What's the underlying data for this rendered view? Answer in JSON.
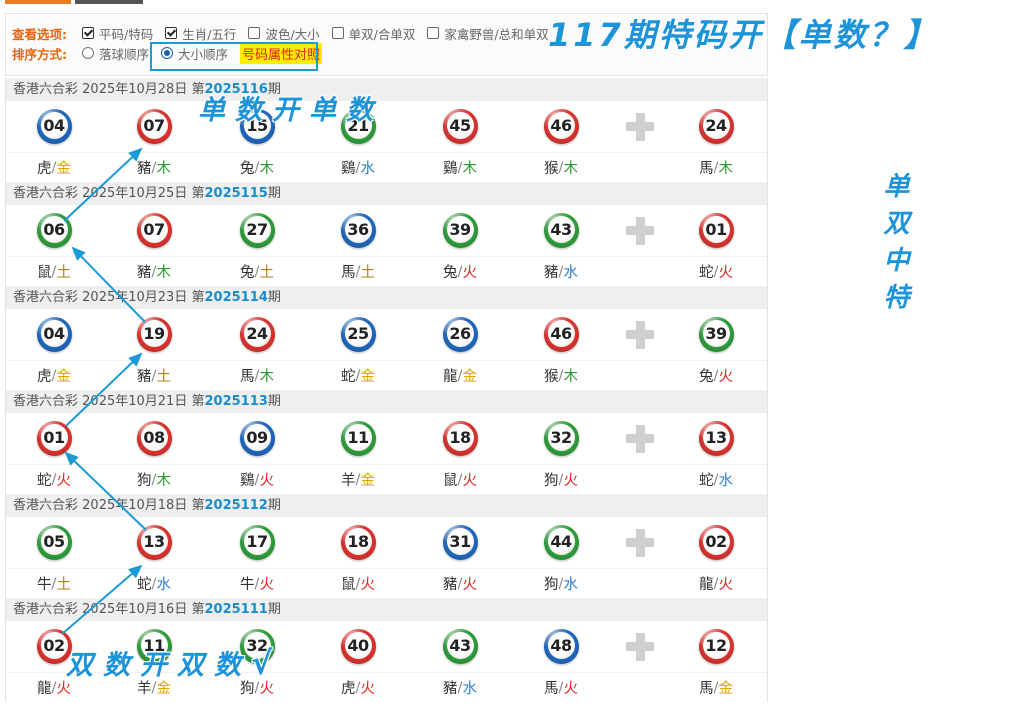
{
  "options": {
    "view_label": "查看选项:",
    "view_items": [
      {
        "label": "平码/特码",
        "checked": true
      },
      {
        "label": "生肖/五行",
        "checked": true
      },
      {
        "label": "波色/大小",
        "checked": false
      },
      {
        "label": "单双/合单双",
        "checked": false
      },
      {
        "label": "家禽野兽/总和单双",
        "checked": false
      }
    ],
    "sort_label": "排序方式:",
    "sort_items": [
      {
        "label": "落球顺序",
        "selected": false
      },
      {
        "label": "大小顺序",
        "selected": true
      }
    ],
    "attr_link": "号码属性对照"
  },
  "draw_labels": {
    "lottery": "香港六合彩",
    "issue_prefix": "第",
    "issue_suffix": "期",
    "separator": "/"
  },
  "draws": [
    {
      "date": "2025年10月28日",
      "issue": "2025116",
      "balls": [
        {
          "num": "04",
          "color": "blue",
          "zodiac": "虎",
          "element": "金"
        },
        {
          "num": "07",
          "color": "red",
          "zodiac": "豬",
          "element": "木"
        },
        {
          "num": "15",
          "color": "blue",
          "zodiac": "兔",
          "element": "木"
        },
        {
          "num": "21",
          "color": "green",
          "zodiac": "鷄",
          "element": "水"
        },
        {
          "num": "45",
          "color": "red",
          "zodiac": "鷄",
          "element": "木"
        },
        {
          "num": "46",
          "color": "red",
          "zodiac": "猴",
          "element": "木"
        }
      ],
      "special": {
        "num": "24",
        "color": "red",
        "zodiac": "馬",
        "element": "木"
      }
    },
    {
      "date": "2025年10月25日",
      "issue": "2025115",
      "balls": [
        {
          "num": "06",
          "color": "green",
          "zodiac": "鼠",
          "element": "土"
        },
        {
          "num": "07",
          "color": "red",
          "zodiac": "豬",
          "element": "木"
        },
        {
          "num": "27",
          "color": "green",
          "zodiac": "兔",
          "element": "土"
        },
        {
          "num": "36",
          "color": "blue",
          "zodiac": "馬",
          "element": "土"
        },
        {
          "num": "39",
          "color": "green",
          "zodiac": "兔",
          "element": "火"
        },
        {
          "num": "43",
          "color": "green",
          "zodiac": "豬",
          "element": "水"
        }
      ],
      "special": {
        "num": "01",
        "color": "red",
        "zodiac": "蛇",
        "element": "火"
      }
    },
    {
      "date": "2025年10月23日",
      "issue": "2025114",
      "balls": [
        {
          "num": "04",
          "color": "blue",
          "zodiac": "虎",
          "element": "金"
        },
        {
          "num": "19",
          "color": "red",
          "zodiac": "豬",
          "element": "土"
        },
        {
          "num": "24",
          "color": "red",
          "zodiac": "馬",
          "element": "木"
        },
        {
          "num": "25",
          "color": "blue",
          "zodiac": "蛇",
          "element": "金"
        },
        {
          "num": "26",
          "color": "blue",
          "zodiac": "龍",
          "element": "金"
        },
        {
          "num": "46",
          "color": "red",
          "zodiac": "猴",
          "element": "木"
        }
      ],
      "special": {
        "num": "39",
        "color": "green",
        "zodiac": "兔",
        "element": "火"
      }
    },
    {
      "date": "2025年10月21日",
      "issue": "2025113",
      "balls": [
        {
          "num": "01",
          "color": "red",
          "zodiac": "蛇",
          "element": "火"
        },
        {
          "num": "08",
          "color": "red",
          "zodiac": "狗",
          "element": "木"
        },
        {
          "num": "09",
          "color": "blue",
          "zodiac": "鷄",
          "element": "火"
        },
        {
          "num": "11",
          "color": "green",
          "zodiac": "羊",
          "element": "金"
        },
        {
          "num": "18",
          "color": "red",
          "zodiac": "鼠",
          "element": "火"
        },
        {
          "num": "32",
          "color": "green",
          "zodiac": "狗",
          "element": "火"
        }
      ],
      "special": {
        "num": "13",
        "color": "red",
        "zodiac": "蛇",
        "element": "水"
      }
    },
    {
      "date": "2025年10月18日",
      "issue": "2025112",
      "balls": [
        {
          "num": "05",
          "color": "green",
          "zodiac": "牛",
          "element": "土"
        },
        {
          "num": "13",
          "color": "red",
          "zodiac": "蛇",
          "element": "水"
        },
        {
          "num": "17",
          "color": "green",
          "zodiac": "牛",
          "element": "火"
        },
        {
          "num": "18",
          "color": "red",
          "zodiac": "鼠",
          "element": "火"
        },
        {
          "num": "31",
          "color": "blue",
          "zodiac": "豬",
          "element": "火"
        },
        {
          "num": "44",
          "color": "green",
          "zodiac": "狗",
          "element": "水"
        }
      ],
      "special": {
        "num": "02",
        "color": "red",
        "zodiac": "龍",
        "element": "火"
      }
    },
    {
      "date": "2025年10月16日",
      "issue": "2025111",
      "balls": [
        {
          "num": "02",
          "color": "red",
          "zodiac": "龍",
          "element": "火"
        },
        {
          "num": "11",
          "color": "green",
          "zodiac": "羊",
          "element": "金"
        },
        {
          "num": "32",
          "color": "green",
          "zodiac": "狗",
          "element": "火"
        },
        {
          "num": "40",
          "color": "red",
          "zodiac": "虎",
          "element": "火"
        },
        {
          "num": "43",
          "color": "green",
          "zodiac": "豬",
          "element": "水"
        },
        {
          "num": "48",
          "color": "blue",
          "zodiac": "馬",
          "element": "火"
        }
      ],
      "special": {
        "num": "12",
        "color": "red",
        "zodiac": "馬",
        "element": "金"
      }
    }
  ],
  "annotations": {
    "headline": "117期特码开【单数？】",
    "odd_note": "单数开单数",
    "even_note": "双数开双数",
    "check_mark": "√",
    "side_note": "单双中特"
  },
  "palette": {
    "ball": {
      "red": "#d8322e",
      "blue": "#1f66bb",
      "green": "#2e9a3a"
    },
    "element": {
      "金": "#e0a300",
      "木": "#2b9a2b",
      "水": "#2a7fd4",
      "火": "#e4231c",
      "土": "#b27c16"
    }
  }
}
